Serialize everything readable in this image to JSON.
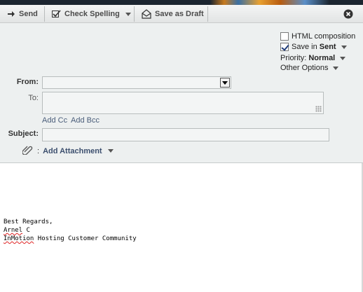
{
  "toolbar": {
    "send_label": "Send",
    "spelling_label": "Check Spelling",
    "draft_label": "Save as Draft"
  },
  "options": {
    "html_composition": "HTML composition",
    "html_composition_checked": false,
    "save_in_prefix": "Save in ",
    "save_in_folder": "Sent",
    "save_in_checked": true,
    "priority_prefix": "Priority: ",
    "priority_value": "Normal",
    "other_options": "Other Options"
  },
  "form": {
    "from_label": "From:",
    "from_value": "",
    "to_label": "To:",
    "to_value": "",
    "add_cc": "Add Cc",
    "add_bcc": "Add Bcc",
    "subject_label": "Subject:",
    "subject_value": "",
    "attachment_separator": ":",
    "add_attachment": "Add Attachment"
  },
  "message": {
    "line1": "Best Regards,",
    "name_first": "Arnel",
    "name_rest": " C",
    "company_first": "InMotion",
    "company_rest": " Hosting Customer Community"
  },
  "colors": {
    "toolbar_bg": "#e8eaea",
    "header_bg": "#edf0f0",
    "link": "#4a5d7a"
  }
}
